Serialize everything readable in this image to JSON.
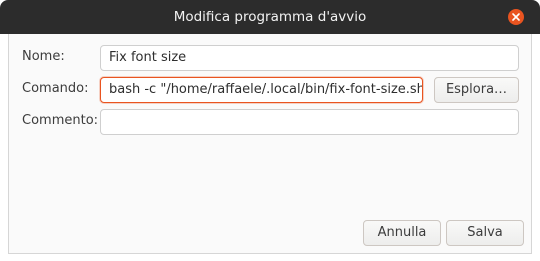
{
  "window": {
    "title": "Modifica programma d'avvio"
  },
  "form": {
    "name_label": "Nome:",
    "name_value": "Fix font size",
    "command_label": "Comando:",
    "command_value": "bash -c \"/home/raffaele/.local/bin/fix-font-size.sh\"",
    "comment_label": "Commento:",
    "comment_value": "",
    "browse_label": "Esplora…"
  },
  "actions": {
    "cancel_label": "Annulla",
    "save_label": "Salva"
  },
  "colors": {
    "titlebar": "#2c2c2c",
    "accent": "#e95420"
  }
}
